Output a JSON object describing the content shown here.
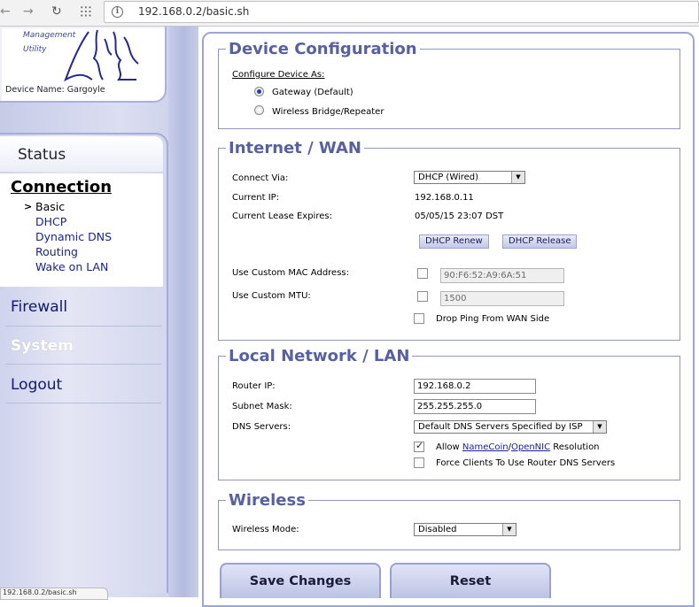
{
  "browser": {
    "url": "192.168.0.2/basic.sh"
  },
  "sidebar": {
    "logo_line1": "Management",
    "logo_line2": "Utility",
    "device_name": "Device Name: Gargoyle",
    "status": "Status",
    "connection": "Connection",
    "sub_items": [
      "Basic",
      "DHCP",
      "Dynamic DNS",
      "Routing",
      "Wake on LAN"
    ],
    "firewall": "Firewall",
    "system": "System",
    "logout": "Logout",
    "status_tip": "192.168.0.2/basic.sh"
  },
  "device_config": {
    "legend": "Device Configuration",
    "configure_label": "Configure Device As:",
    "option_gateway": "Gateway (Default)",
    "option_bridge": "Wireless Bridge/Repeater",
    "selected": "gateway"
  },
  "wan": {
    "legend": "Internet / WAN",
    "connect_via_label": "Connect Via:",
    "connect_via_value": "DHCP (Wired)",
    "current_ip_label": "Current IP:",
    "current_ip_value": "192.168.0.11",
    "lease_label": "Current Lease Expires:",
    "lease_value": "05/05/15 23:07 DST",
    "renew_button": "DHCP Renew",
    "release_button": "DHCP Release",
    "custom_mac_label": "Use Custom MAC Address:",
    "custom_mac_value": "90:F6:52:A9:6A:51",
    "custom_mac_checked": false,
    "custom_mtu_label": "Use Custom MTU:",
    "custom_mtu_value": "1500",
    "custom_mtu_checked": false,
    "drop_ping_label": "Drop Ping From WAN Side",
    "drop_ping_checked": false
  },
  "lan": {
    "legend": "Local Network / LAN",
    "router_ip_label": "Router IP:",
    "router_ip_value": "192.168.0.2",
    "subnet_label": "Subnet Mask:",
    "subnet_value": "255.255.255.0",
    "dns_label": "DNS Servers:",
    "dns_value": "Default DNS Servers Specified by ISP",
    "allow_prefix": "Allow ",
    "allow_namecoin": "NameCoin",
    "allow_sep": "/",
    "allow_opennic": "OpenNIC",
    "allow_suffix": " Resolution",
    "allow_checked": true,
    "force_clients_label": "Force Clients To Use Router DNS Servers",
    "force_clients_checked": false
  },
  "wireless": {
    "legend": "Wireless",
    "mode_label": "Wireless Mode:",
    "mode_value": "Disabled"
  },
  "actions": {
    "save": "Save Changes",
    "reset": "Reset"
  },
  "colors": {
    "accent": "#5861a0",
    "menu_text": "#12186e",
    "link": "#1b2390"
  }
}
